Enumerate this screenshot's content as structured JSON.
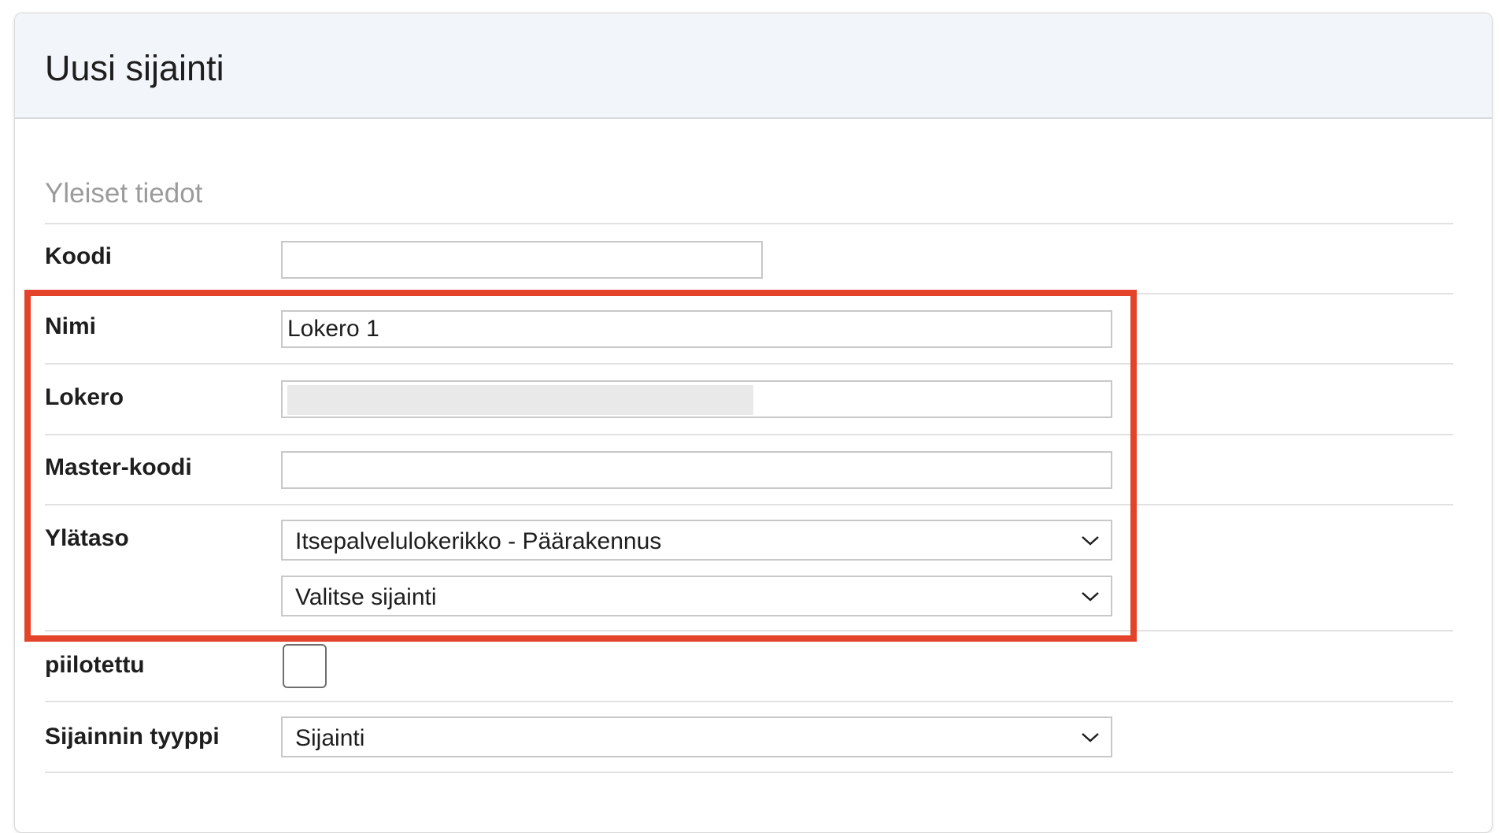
{
  "card": {
    "title": "Uusi sijainti"
  },
  "section": {
    "title": "Yleiset tiedot"
  },
  "fields": {
    "koodi": {
      "label": "Koodi",
      "value": ""
    },
    "nimi": {
      "label": "Nimi",
      "value": "Lokero 1"
    },
    "lokero": {
      "label": "Lokero",
      "value": ""
    },
    "master_koodi": {
      "label": "Master-koodi",
      "value": ""
    },
    "ylataso": {
      "label": "Ylätaso",
      "select1_value": "Itsepalvelulokerikko - Päärakennus",
      "select2_value": "Valitse sijainti"
    },
    "piilotettu": {
      "label": "piilotettu",
      "checked": false
    },
    "sijainnin_tyyppi": {
      "label": "Sijainnin tyyppi",
      "value": "Sijainti"
    }
  },
  "colors": {
    "highlight": "#e24329",
    "header_bg": "#f2f5f9"
  },
  "icons": {
    "select_arrow": "chevron-down-icon"
  }
}
